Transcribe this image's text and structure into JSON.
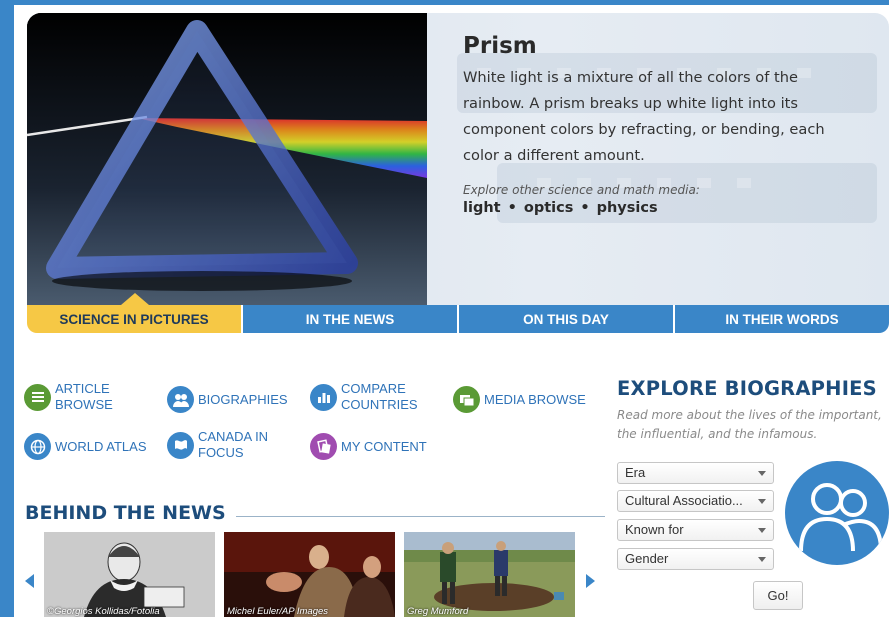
{
  "hero": {
    "title": "Prism",
    "description": "White light is a mixture of all the colors of the rainbow. A prism breaks up white light into its component colors by refracting, or bending, each color a different amount.",
    "explore_label": "Explore other science and math media:",
    "tags": [
      "light",
      "optics",
      "physics"
    ],
    "tag_separator": "•"
  },
  "tabs": [
    {
      "label": "SCIENCE IN PICTURES",
      "active": true
    },
    {
      "label": "IN THE NEWS",
      "active": false
    },
    {
      "label": "ON THIS DAY",
      "active": false
    },
    {
      "label": "IN THEIR WORDS",
      "active": false
    }
  ],
  "links": [
    {
      "label": "ARTICLE BROWSE",
      "lines": [
        "ARTICLE",
        "BROWSE"
      ],
      "icon": "list-icon",
      "color": "#5a9a35"
    },
    {
      "label": "BIOGRAPHIES",
      "lines": [
        "BIOGRAPHIES"
      ],
      "icon": "people-icon",
      "color": "#3a86c8"
    },
    {
      "label": "COMPARE COUNTRIES",
      "lines": [
        "COMPARE",
        "COUNTRIES"
      ],
      "icon": "bar-chart-icon",
      "color": "#3a86c8"
    },
    {
      "label": "MEDIA BROWSE",
      "lines": [
        "MEDIA BROWSE"
      ],
      "icon": "media-icon",
      "color": "#5a9a35"
    },
    {
      "label": "WORLD ATLAS",
      "lines": [
        "WORLD ATLAS"
      ],
      "icon": "globe-icon",
      "color": "#3a86c8"
    },
    {
      "label": "CANADA IN FOCUS",
      "lines": [
        "CANADA IN",
        "FOCUS"
      ],
      "icon": "flag-icon",
      "color": "#3a86c8"
    },
    {
      "label": "MY CONTENT",
      "lines": [
        "MY CONTENT"
      ],
      "icon": "my-content-icon",
      "color": "#a04cb0"
    }
  ],
  "behind_the_news": {
    "title": "BEHIND THE NEWS",
    "items": [
      {
        "credit": "©Georgios Kollidas/Fotolia"
      },
      {
        "credit": "Michel Euler/AP Images"
      },
      {
        "credit": "Greg Mumford"
      }
    ]
  },
  "explore_biographies": {
    "title": "EXPLORE BIOGRAPHIES",
    "description": "Read more about the lives of the important, the influential, and the infamous.",
    "selects": [
      {
        "value": "Era"
      },
      {
        "value": "Cultural Associatio..."
      },
      {
        "value": "Known for"
      },
      {
        "value": "Gender"
      }
    ],
    "go_label": "Go!"
  },
  "colors": {
    "brand_blue": "#3a86c8",
    "heading_navy": "#1d4d7c",
    "active_tab_yellow": "#f6c845",
    "link_blue": "#2f73b8"
  }
}
